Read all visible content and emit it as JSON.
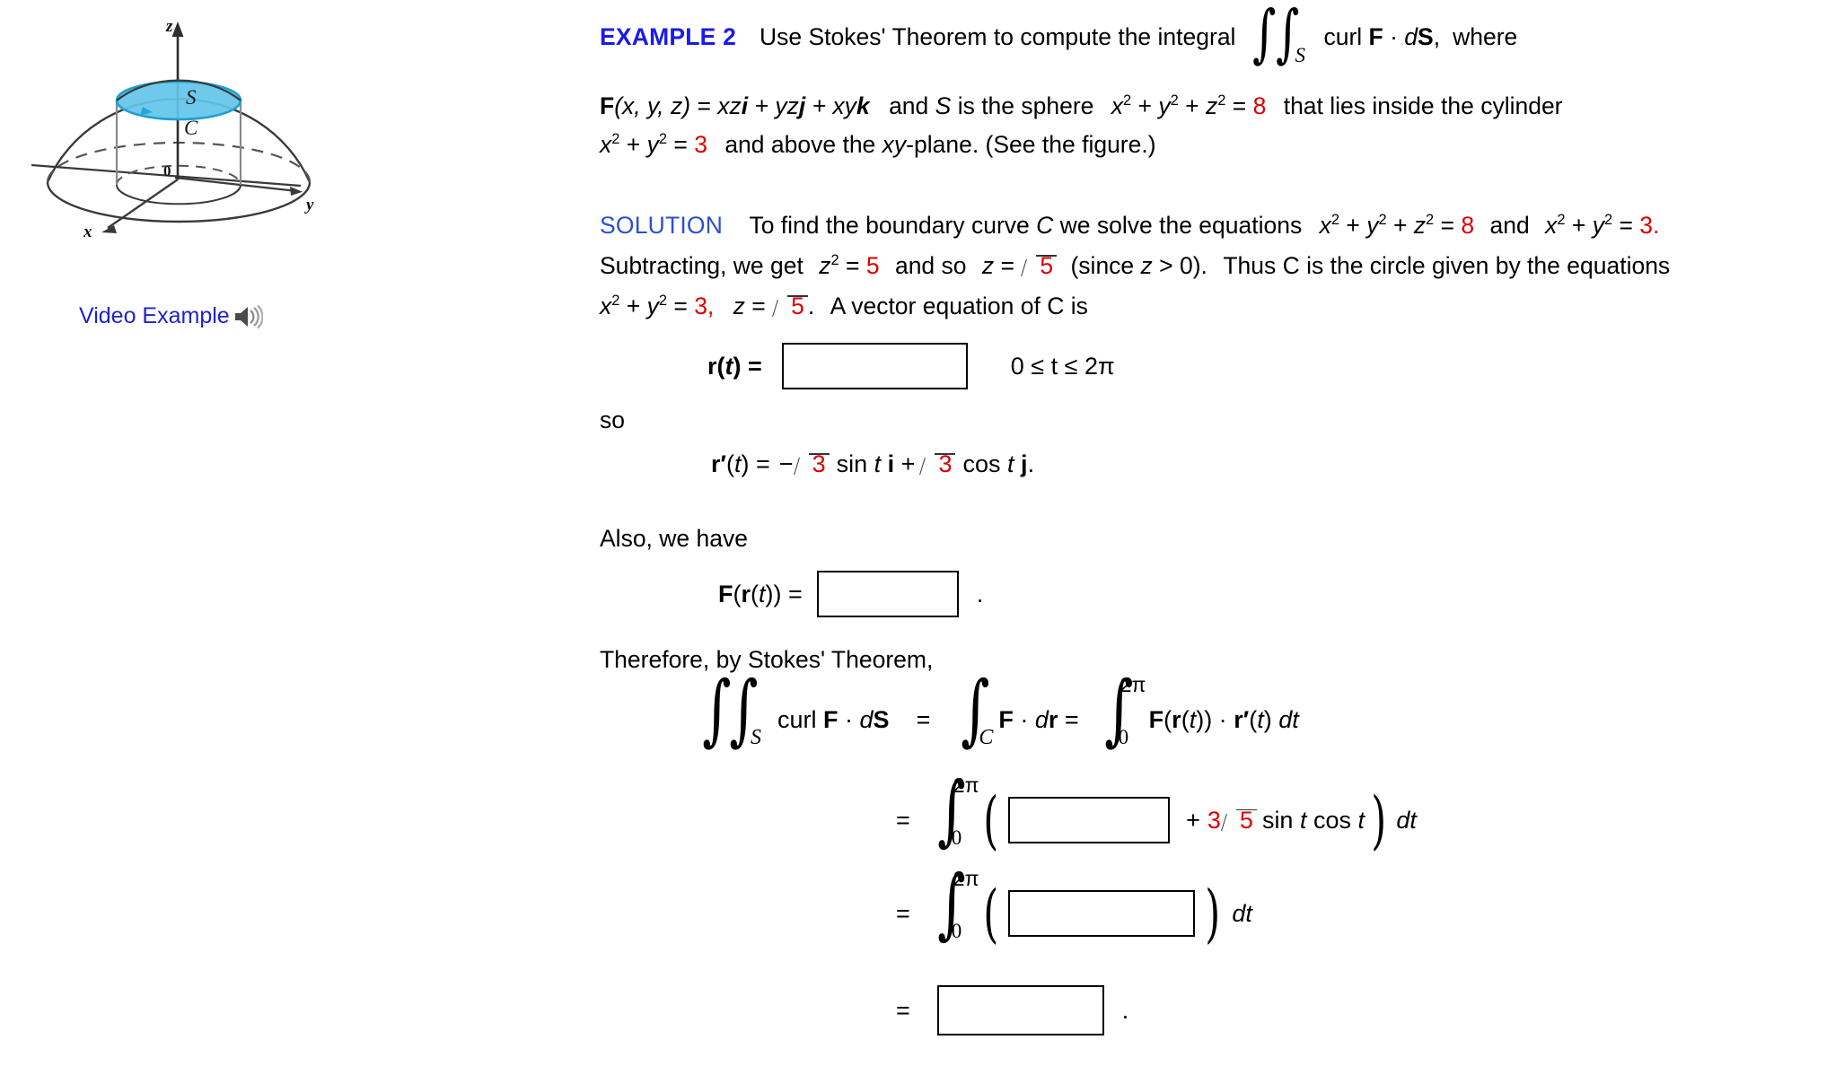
{
  "figure": {
    "axis_labels": {
      "z": "z",
      "y": "y",
      "x": "x",
      "origin": "0"
    },
    "surface_label": "S",
    "curve_label": "C",
    "description": "Hemisphere with vertical cylinder; blue disk cap labeled S bounded by circle C",
    "colors": {
      "cap_fill": "#5fc3e8",
      "cap_stroke": "#1f9fd4",
      "line": "#3a3a3a"
    }
  },
  "video_example": {
    "label": "Video Example",
    "icon": "speaker-icon",
    "color": "#2222cc"
  },
  "example": {
    "tag": "EXAMPLE 2",
    "tag_color": "#1a1aee",
    "line1_a": "Use Stokes' Theorem to compute the integral",
    "integral_sub": "S",
    "integral_body": "curl F · dS,",
    "line1_b": "where",
    "field_lhs": "F(x, y, z) =",
    "field_rhs": "xzi + yzj + xyk",
    "line2_mid": "and S is the sphere",
    "sphere_eq": "x² + y² + z² =",
    "sphere_value": "8",
    "line2_end": "that lies inside the cylinder",
    "cylinder_eq": "x² + y² =",
    "cylinder_value": "3",
    "line3_end": "and above the xy-plane. (See the figure.)"
  },
  "solution": {
    "tag": "SOLUTION",
    "tag_color": "#2b4fd6",
    "s1": "To find the boundary curve C we solve the equations",
    "s1_eq1": "x² + y² + z² =",
    "s1_eq1_value": "8",
    "s1_and": "and",
    "s1_eq2": "x² + y² =",
    "s1_eq2_value": "3.",
    "s2_start": "Subtracting, we get",
    "s2_z2": "z² =",
    "s2_z2_value": "5",
    "s2_mid": "and so",
    "s2_z": "z =",
    "s2_sqrt_value": "5",
    "s2_since": "(since",
    "s2_zgt": "z > 0).",
    "s2_end": "Thus C is the circle given by the equations",
    "s3_eq1": "x² + y² =",
    "s3_eq1_value": "3,",
    "s3_eq2": "z =",
    "s3_eq2_value": "5",
    "s3_period": ".",
    "s3_end": "A vector equation of C is",
    "so_label": "so",
    "also_label": "Also, we have",
    "therefore_label": "Therefore, by Stokes' Theorem,"
  },
  "rt_row": {
    "lhs": "r(t) =",
    "answer": "",
    "placeholder": "",
    "domain": "0 ≤ t ≤ 2π"
  },
  "rprime_row": {
    "lhs": "r′(t) =",
    "minus": "−",
    "sqrt1_value": "3",
    "mid": "sin t i +",
    "sqrt2_value": "3",
    "end": "cos t j."
  },
  "frt_row": {
    "lhs": "F(r(t)) =",
    "answer": "",
    "period": "."
  },
  "stokes_chain": {
    "line1": {
      "lhs_sub": "S",
      "lhs_body": "curl F · dS",
      "eq1": "=",
      "mid_sub": "C",
      "mid_body": "F · dr =",
      "rhs_lower": "0",
      "rhs_upper": "2π",
      "rhs_body": "F(r(t)) · r′(t) dt"
    },
    "line2": {
      "eq": "=",
      "lower": "0",
      "upper": "2π",
      "answer": "",
      "tail_plus": "+",
      "tail_coeff": "3",
      "tail_sqrt_value": "5",
      "tail_trig": "sin t cos t",
      "tail_dt": "dt"
    },
    "line3": {
      "eq": "=",
      "lower": "0",
      "upper": "2π",
      "answer": "",
      "tail_dt": "dt"
    },
    "line4": {
      "eq": "=",
      "answer": "",
      "period": "."
    }
  }
}
